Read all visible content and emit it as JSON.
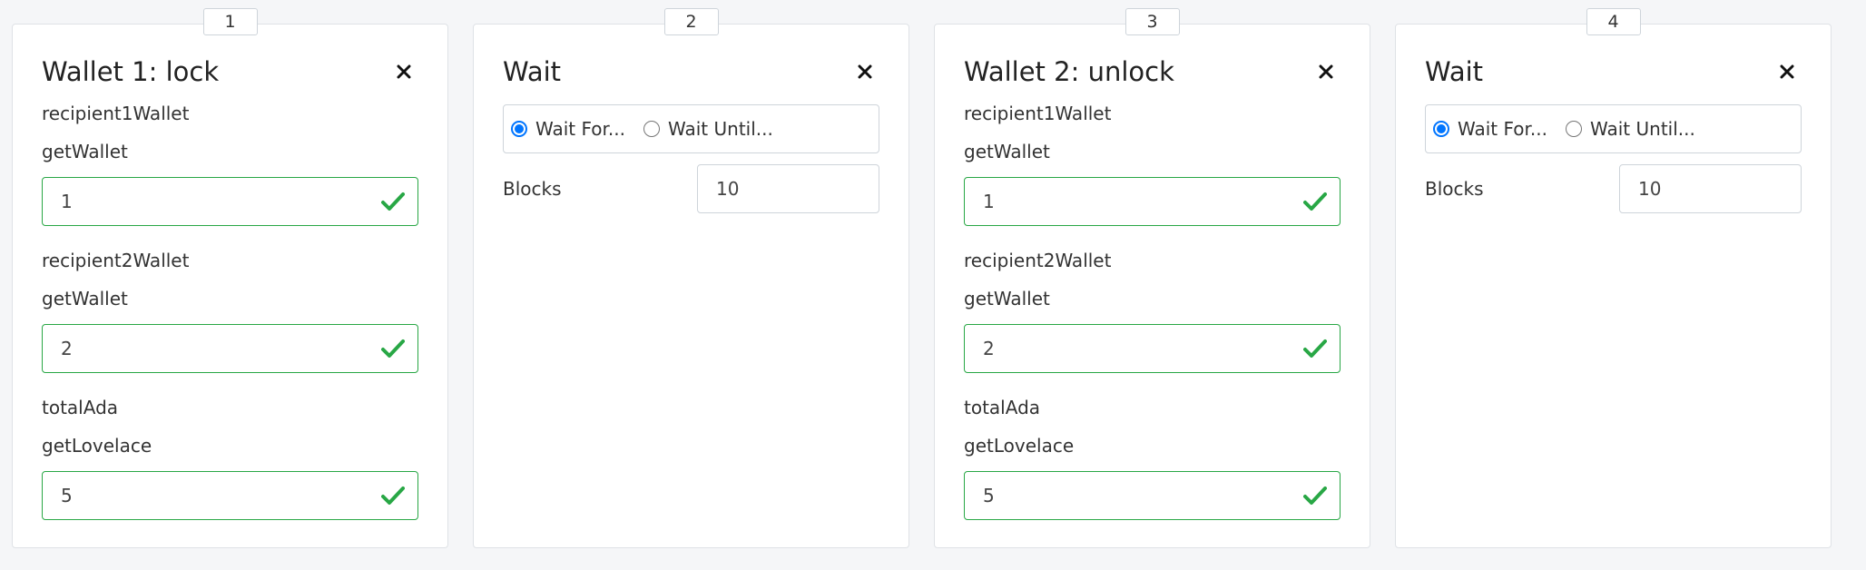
{
  "colors": {
    "valid": "#28a745",
    "radio_checked": "#0075ff",
    "border": "#ced4da",
    "background": "#f5f6f8"
  },
  "steps": [
    {
      "badge": "1",
      "title": "Wallet 1: lock",
      "params": [
        {
          "name": "recipient1Wallet",
          "func": "getWallet",
          "value": "1"
        },
        {
          "name": "recipient2Wallet",
          "func": "getWallet",
          "value": "2"
        },
        {
          "name": "totalAda",
          "func": "getLovelace",
          "value": "5"
        }
      ]
    },
    {
      "badge": "2",
      "title": "Wait",
      "options": [
        {
          "label": "Wait For...",
          "checked": true
        },
        {
          "label": "Wait Until...",
          "checked": false
        }
      ],
      "blocks_label": "Blocks",
      "blocks_value": "10"
    },
    {
      "badge": "3",
      "title": "Wallet 2: unlock",
      "params": [
        {
          "name": "recipient1Wallet",
          "func": "getWallet",
          "value": "1"
        },
        {
          "name": "recipient2Wallet",
          "func": "getWallet",
          "value": "2"
        },
        {
          "name": "totalAda",
          "func": "getLovelace",
          "value": "5"
        }
      ]
    },
    {
      "badge": "4",
      "title": "Wait",
      "options": [
        {
          "label": "Wait For...",
          "checked": true
        },
        {
          "label": "Wait Until...",
          "checked": false
        }
      ],
      "blocks_label": "Blocks",
      "blocks_value": "10"
    }
  ]
}
